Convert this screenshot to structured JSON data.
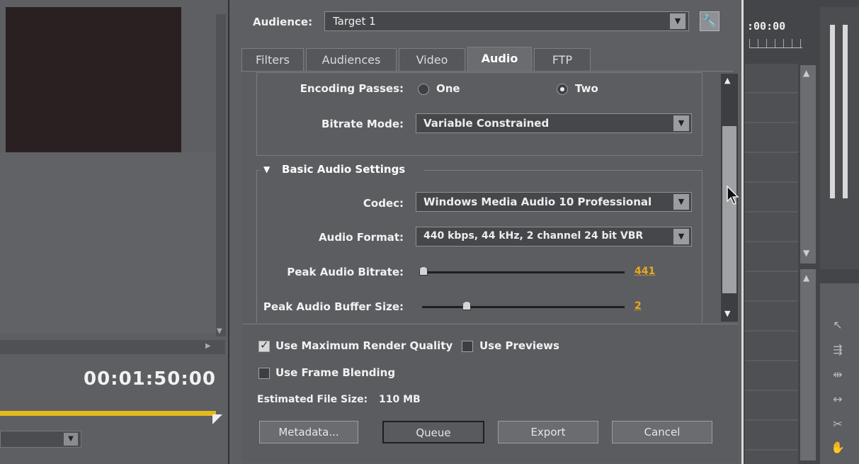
{
  "dialog": {
    "audience_label": "Audience:",
    "audience_value": "Target 1",
    "tabs": [
      {
        "label": "Filters"
      },
      {
        "label": "Audiences"
      },
      {
        "label": "Video"
      },
      {
        "label": "Audio"
      },
      {
        "label": "FTP"
      }
    ],
    "active_tab": "Audio",
    "encoding": {
      "passes_label": "Encoding Passes:",
      "option_one": "One",
      "option_two": "Two",
      "selected": "Two",
      "bitrate_mode_label": "Bitrate Mode:",
      "bitrate_mode_value": "Variable Constrained"
    },
    "basic_audio": {
      "section_title": "Basic Audio Settings",
      "codec_label": "Codec:",
      "codec_value": "Windows Media Audio 10 Professional",
      "format_label": "Audio Format:",
      "format_value": "440 kbps, 44 kHz, 2 channel 24 bit VBR",
      "peak_bitrate_label": "Peak Audio Bitrate:",
      "peak_bitrate_value": "441",
      "peak_bitrate_fraction": 0.0,
      "peak_buffer_label": "Peak Audio Buffer Size:",
      "peak_buffer_value": "2",
      "peak_buffer_fraction": 0.2
    },
    "options": {
      "max_render_quality_label": "Use Maximum Render Quality",
      "max_render_quality_checked": true,
      "use_previews_label": "Use Previews",
      "use_previews_checked": false,
      "frame_blending_label": "Use Frame Blending",
      "frame_blending_checked": false,
      "estimated_size_label": "Estimated File Size:",
      "estimated_size_value": "110 MB"
    },
    "buttons": {
      "metadata": "Metadata...",
      "queue": "Queue",
      "export": "Export",
      "cancel": "Cancel"
    }
  },
  "left_panel": {
    "timecode": "00:01:50:00",
    "progress_fraction": 1.0
  },
  "right_panel": {
    "timecode": ":00:00"
  },
  "icons": {
    "wrench": "wrench-icon",
    "dropdown": "chevron-down-icon",
    "collapse": "triangle-down-icon"
  },
  "colors": {
    "accent_value": "#e8a820",
    "progress": "#e4b91b"
  }
}
